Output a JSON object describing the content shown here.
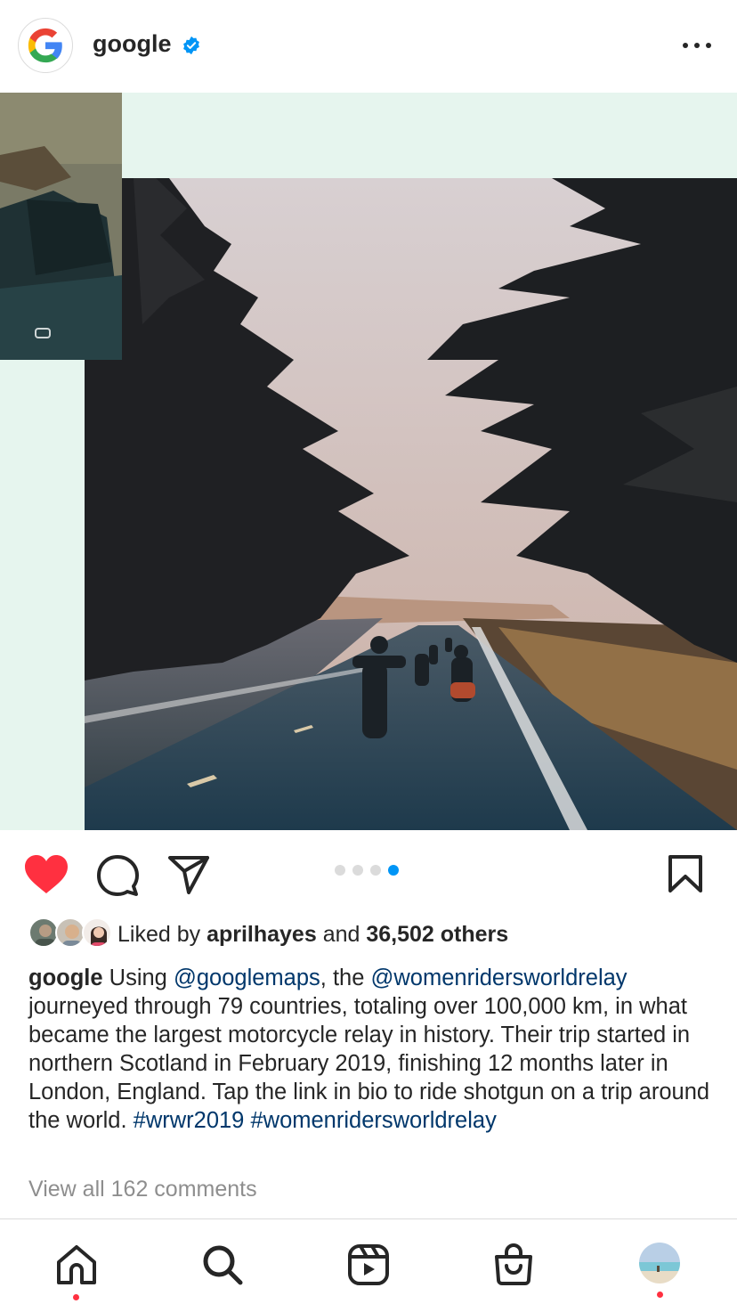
{
  "header": {
    "username": "google",
    "verified": true,
    "more_icon": "more-horizontal-icon"
  },
  "post": {
    "carousel": {
      "total": 4,
      "active_index": 3
    },
    "liked": true
  },
  "colors": {
    "like_red": "#ff3040",
    "verified_blue": "#0095f6",
    "link_blue": "#00376b",
    "mint_background": "#e6f5ee"
  },
  "likes": {
    "prefix": "Liked by ",
    "user": "aprilhayes",
    "middle": " and ",
    "count": "36,502 others"
  },
  "caption": {
    "author": "google",
    "t1": " Using ",
    "mention1": "@googlemaps",
    "t2": ", the ",
    "mention2": "@womenridersworldrelay",
    "t3": " journeyed through 79 countries, totaling over 100,000 km, in what became the largest motorcycle relay in history. Their trip started in northern Scotland in February 2019, finishing 12 months later in London, England. Tap the link in bio to ride shotgun on a trip around the world. ",
    "hashtag1": "#wrwr2019",
    "hashtag2": "#womenridersworldrelay"
  },
  "comments_link": "View all 162 comments",
  "nav": {
    "items": [
      "home-icon",
      "search-icon",
      "reels-icon",
      "shop-icon",
      "profile-avatar"
    ],
    "notification_dots": [
      "home",
      "profile"
    ]
  }
}
